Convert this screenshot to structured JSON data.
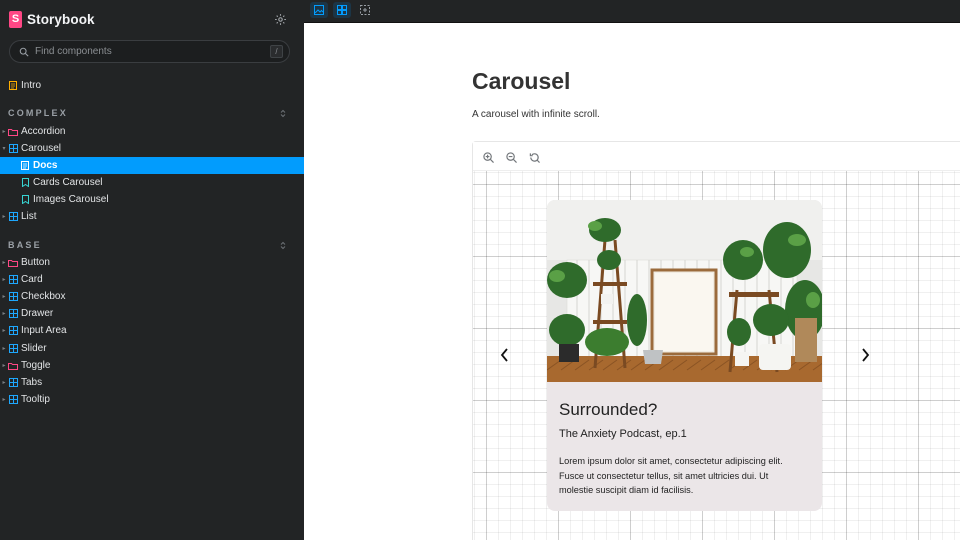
{
  "sidebar": {
    "brand": {
      "logo_letter": "S",
      "name": "Storybook"
    },
    "search": {
      "placeholder": "Find components",
      "shortcut": "/"
    },
    "intro": {
      "label": "Intro"
    },
    "sections": [
      {
        "title": "COMPLEX"
      },
      {
        "title": "BASE"
      }
    ],
    "complex_items": [
      {
        "label": "Accordion",
        "icon": "folder-icon"
      },
      {
        "label": "Carousel",
        "icon": "component-icon"
      },
      {
        "label": "Docs",
        "icon": "document-icon",
        "active": true
      },
      {
        "label": "Cards Carousel",
        "icon": "bookmark-icon"
      },
      {
        "label": "Images Carousel",
        "icon": "bookmark-icon"
      },
      {
        "label": "List",
        "icon": "component-icon"
      }
    ],
    "base_items": [
      {
        "label": "Button",
        "icon": "folder-icon"
      },
      {
        "label": "Card",
        "icon": "component-icon"
      },
      {
        "label": "Checkbox",
        "icon": "component-icon"
      },
      {
        "label": "Drawer",
        "icon": "component-icon"
      },
      {
        "label": "Input Area",
        "icon": "component-icon"
      },
      {
        "label": "Slider",
        "icon": "component-icon"
      },
      {
        "label": "Toggle",
        "icon": "folder-icon"
      },
      {
        "label": "Tabs",
        "icon": "component-icon"
      },
      {
        "label": "Tooltip",
        "icon": "component-icon"
      }
    ]
  },
  "toolbar": {
    "buttons": [
      "image-icon",
      "grid-icon",
      "outline-icon"
    ]
  },
  "docs": {
    "title": "Carousel",
    "description": "A carousel with infinite scroll."
  },
  "canvas": {
    "zoom_buttons": [
      "zoom-in-icon",
      "zoom-out-icon",
      "zoom-reset-icon"
    ]
  },
  "card": {
    "title": "Surrounded?",
    "subtitle": "The Anxiety Podcast, ep.1",
    "body": "Lorem ipsum dolor sit amet, consectetur adipiscing elit. Fusce ut consectetur tellus, sit amet ultricies dui. Ut molestie suscipit diam id facilisis."
  },
  "colors": {
    "accent": "#029cfd",
    "sidebar_bg": "#222425",
    "brand": "#ff4785",
    "folder": "#ff4785",
    "component": "#1ea7fd",
    "story": "#37d5d3",
    "doc": "#ffae00"
  }
}
